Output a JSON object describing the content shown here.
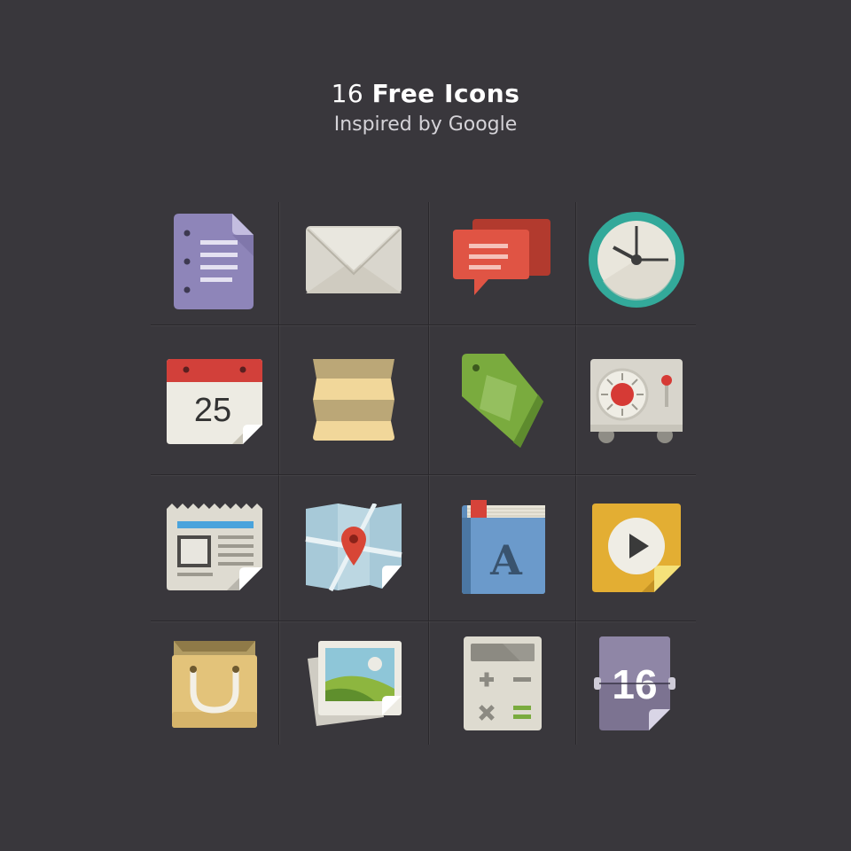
{
  "header": {
    "title_number": "16",
    "title_text": "Free Icons",
    "subtitle": "Inspired by Google"
  },
  "icons": [
    {
      "name": "document-icon"
    },
    {
      "name": "mail-icon"
    },
    {
      "name": "chat-icon"
    },
    {
      "name": "clock-icon"
    },
    {
      "name": "calendar-icon",
      "label": "25"
    },
    {
      "name": "folded-paper-icon"
    },
    {
      "name": "tag-icon"
    },
    {
      "name": "safe-icon"
    },
    {
      "name": "newspaper-icon"
    },
    {
      "name": "map-icon"
    },
    {
      "name": "book-icon",
      "label": "A"
    },
    {
      "name": "play-icon"
    },
    {
      "name": "shopping-bag-icon"
    },
    {
      "name": "photos-icon"
    },
    {
      "name": "calculator-icon"
    },
    {
      "name": "date-flip-icon",
      "label": "16"
    }
  ],
  "colors": {
    "background": "#39373c",
    "purple": "#8e85b9",
    "red": "#e05444",
    "teal": "#33a99a",
    "green": "#7aab3e",
    "gold": "#e3ae33",
    "blue": "#5e8dbd"
  }
}
